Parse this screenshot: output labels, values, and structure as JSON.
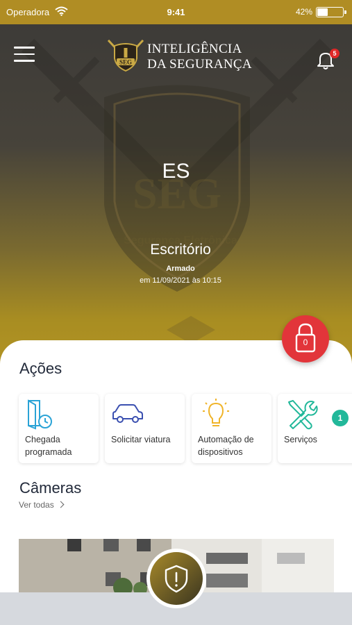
{
  "status_bar": {
    "carrier": "Operadora",
    "time": "9:41",
    "battery_text": "42%",
    "battery_level": 0.42
  },
  "header": {
    "brand_line1": "INTELIGÊNCIA",
    "brand_line2": "DA SEGURANÇA",
    "logo_text": "SEG",
    "notification_count": "5"
  },
  "site": {
    "code": "ES",
    "name": "Escritório",
    "status": "Armado",
    "status_date": "em 11/09/2021 às 10:15"
  },
  "lock_button": {
    "count": "0"
  },
  "actions": {
    "title": "Ações",
    "items": [
      {
        "label": "Chegada programada",
        "icon": "scheduled-arrival-icon"
      },
      {
        "label": "Solicitar viatura",
        "icon": "car-icon"
      },
      {
        "label": "Automação de dispositivos",
        "icon": "lightbulb-icon"
      },
      {
        "label": "Serviços",
        "icon": "tools-icon"
      }
    ],
    "services_badge": "1"
  },
  "cameras": {
    "title": "Câmeras",
    "see_all": "Ver todas"
  },
  "colors": {
    "gold": "#b08d24",
    "red": "#e2353a",
    "teal": "#22b89a",
    "icon_blue": "#3a4fb0",
    "icon_cyan": "#2aa3d6",
    "icon_yellow": "#f0b429"
  }
}
